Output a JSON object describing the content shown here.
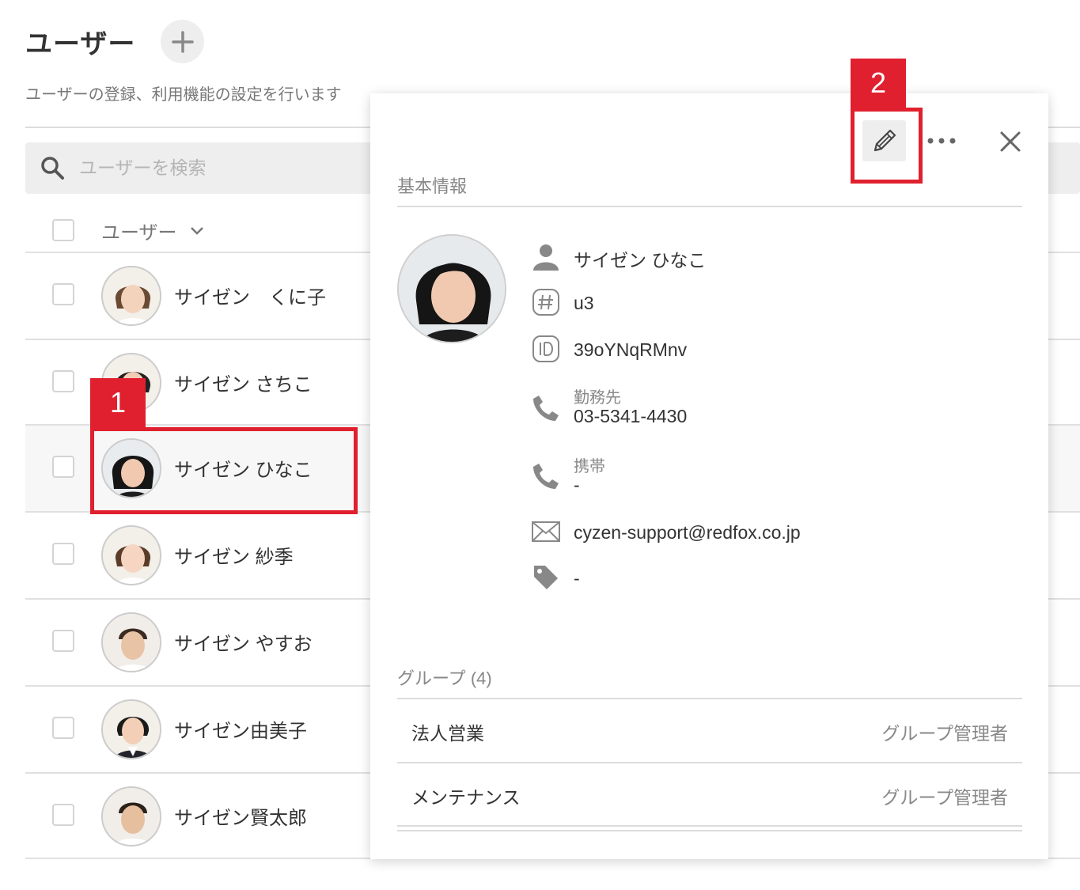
{
  "header": {
    "title": "ユーザー",
    "description": "ユーザーの登録、利用機能の設定を行います"
  },
  "search": {
    "placeholder": "ユーザーを検索"
  },
  "list": {
    "column_header": "ユーザー",
    "users": [
      {
        "name": "サイゼン　くに子",
        "avatar": "female"
      },
      {
        "name": "サイゼン さちこ",
        "avatar": "female"
      },
      {
        "name": "サイゼン ひなこ",
        "avatar": "female",
        "selected": true
      },
      {
        "name": "サイゼン 紗季",
        "avatar": "female"
      },
      {
        "name": "サイゼン やすお",
        "avatar": "male"
      },
      {
        "name": "サイゼン由美子",
        "avatar": "female"
      },
      {
        "name": "サイゼン賢太郎",
        "avatar": "male"
      }
    ]
  },
  "annotations": {
    "badge_1": "1",
    "badge_2": "2",
    "color": "#e0202e"
  },
  "panel": {
    "basic_info_title": "基本情報",
    "name": "サイゼン ひなこ",
    "number": "u3",
    "login_id": "39oYNqRMnv",
    "work_phone_label": "勤務先",
    "work_phone": "03-5341-4430",
    "mobile_label": "携帯",
    "mobile": "-",
    "email": "cyzen-support@redfox.co.jp",
    "tags": "-",
    "groups_title": "グループ",
    "groups_count": "(4)",
    "groups": [
      {
        "name": "法人営業",
        "role": "グループ管理者"
      },
      {
        "name": "メンテナンス",
        "role": "グループ管理者"
      }
    ]
  },
  "icons": {
    "add": "plus-icon",
    "search": "search-icon",
    "sort": "chevron-down-icon",
    "edit": "pencil-icon",
    "more": "more-dots-icon",
    "close": "close-icon",
    "person": "person-icon",
    "number": "hash-icon",
    "id": "id-icon",
    "phone": "phone-icon",
    "mail": "mail-icon",
    "tag": "tag-icon"
  }
}
